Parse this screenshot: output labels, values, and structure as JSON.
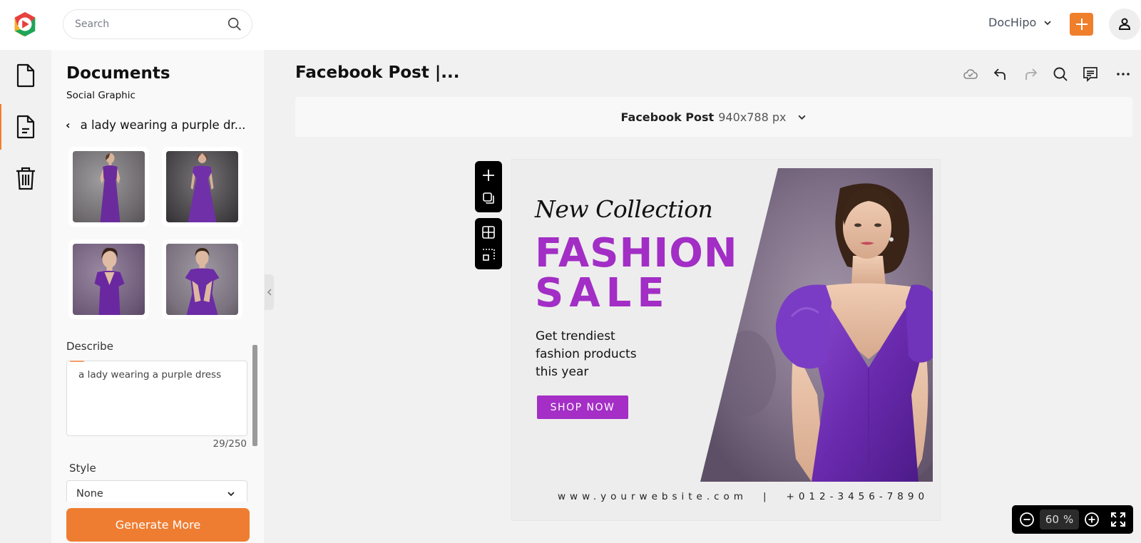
{
  "app": {
    "name": "DocHipo",
    "brand_color": "#f07f2c",
    "accent_purple": "#a22ec5"
  },
  "topbar": {
    "search_placeholder": "Search",
    "search_icon": "search-icon",
    "account_label": "DocHipo",
    "account_icon": "chevron-down-icon",
    "create_icon": "plus-icon",
    "user_icon": "user-icon"
  },
  "rail": {
    "items": [
      {
        "name": "documents",
        "icon": "document-icon",
        "active": false
      },
      {
        "name": "templates",
        "icon": "document-text-icon",
        "active": true
      },
      {
        "name": "trash",
        "icon": "trash-icon",
        "active": false
      }
    ]
  },
  "panel": {
    "title": "Documents",
    "subtitle": "Social Graphic",
    "breadcrumb": "a lady wearing a purple dr...",
    "back_icon": "chevron-left-icon",
    "thumbnails": [
      {
        "alt": "Woman in long purple dress, full length"
      },
      {
        "alt": "Woman in purple satin gown, full length"
      },
      {
        "alt": "Woman in purple V-neck dress, portrait"
      },
      {
        "alt": "Woman in purple ruffle-sleeve dress, portrait"
      }
    ],
    "describe_label": "Describe",
    "describe_value": "a lady wearing a purple dress",
    "char_count": "29/250",
    "style_label": "Style",
    "style_value": "None",
    "generate_label": "Generate More"
  },
  "editor": {
    "doc_title": "Facebook Post |...",
    "toolbar": [
      {
        "name": "cloud-saved",
        "icon": "cloud-check-icon"
      },
      {
        "name": "undo",
        "icon": "undo-icon"
      },
      {
        "name": "redo",
        "icon": "redo-icon"
      },
      {
        "name": "search",
        "icon": "search-icon"
      },
      {
        "name": "comments",
        "icon": "comment-icon"
      },
      {
        "name": "more",
        "icon": "more-icon"
      }
    ],
    "size_type": "Facebook Post",
    "size_dims": "940x788 px",
    "float_tools": [
      "add-page-icon",
      "duplicate-icon",
      "grid-icon",
      "select-area-icon"
    ]
  },
  "design": {
    "script_text": "New Collection",
    "headline_1": "FASHION",
    "headline_2": "SALE",
    "body": [
      "Get trendiest",
      "fashion products",
      "this year"
    ],
    "cta": "SHOP NOW",
    "website": "www.yourwebsite.com",
    "separator": "|",
    "phone": "+012-3456-7890",
    "colors": {
      "headline": "#a22ec5",
      "cta": "#a42ec6",
      "background": "#ededed"
    }
  },
  "zoom": {
    "value": "60",
    "unit": "%"
  }
}
